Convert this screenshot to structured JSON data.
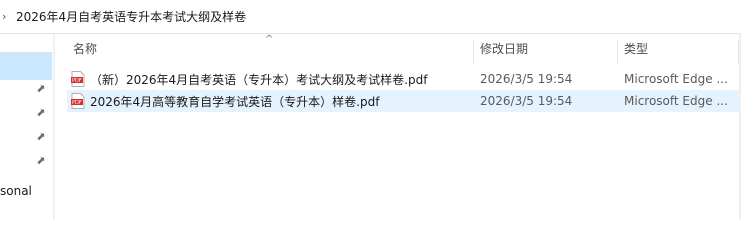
{
  "address": {
    "crumb": "2026年4月自考英语专升本考试大纲及样卷"
  },
  "nav": {
    "truncated_item": "sonal"
  },
  "columns": {
    "name": "名称",
    "date": "修改日期",
    "type": "类型"
  },
  "files": [
    {
      "name": "（新）2026年4月自考英语（专升本）考试大纲及考试样卷.pdf",
      "date": "2026/3/5 19:54",
      "type": "Microsoft Edge ..."
    },
    {
      "name": "2026年4月高等教育自学考试英语（专升本）样卷.pdf",
      "date": "2026/3/5 19:54",
      "type": "Microsoft Edge ..."
    }
  ],
  "icons": {
    "chevron": "chevron-right-icon",
    "pin": "pin-icon",
    "file": "pdf-file-icon"
  },
  "colors": {
    "selection": "#cce8ff",
    "row_highlight": "#e5f3ff",
    "pdf_red": "#d32f2f"
  }
}
